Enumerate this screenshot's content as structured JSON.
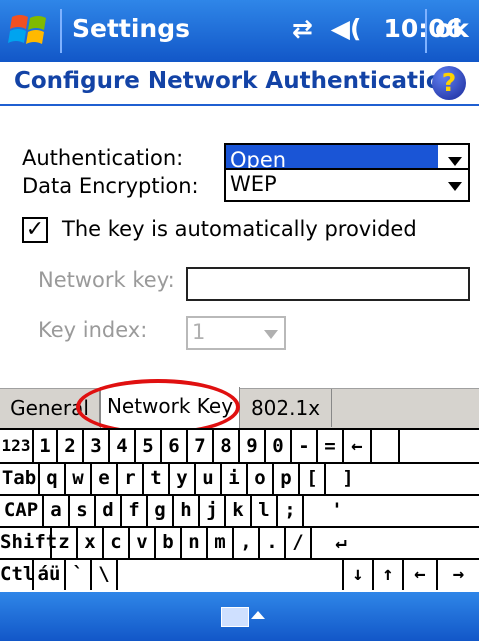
{
  "titlebar": {
    "title": "Settings",
    "time": "10:06",
    "ok_label": "ok"
  },
  "page": {
    "heading": "Configure Network Authentication"
  },
  "form": {
    "authentication": {
      "label": "Authentication:",
      "value": "Open"
    },
    "encryption": {
      "label": "Data Encryption:",
      "value": "WEP"
    },
    "auto_key": {
      "label": "The key is automatically provided",
      "checked": true
    },
    "network_key": {
      "label": "Network key:",
      "value": ""
    },
    "key_index": {
      "label": "Key index:",
      "value": "1"
    }
  },
  "tabs": [
    "General",
    "Network Key",
    "802.1x"
  ],
  "keyboard": {
    "rows": [
      [
        "123",
        "1",
        "2",
        "3",
        "4",
        "5",
        "6",
        "7",
        "8",
        "9",
        "0",
        "-",
        "=",
        "←"
      ],
      [
        "Tab",
        "q",
        "w",
        "e",
        "r",
        "t",
        "y",
        "u",
        "i",
        "o",
        "p",
        "[",
        "]"
      ],
      [
        "CAP",
        "a",
        "s",
        "d",
        "f",
        "g",
        "h",
        "j",
        "k",
        "l",
        ";",
        "'"
      ],
      [
        "Shift",
        "z",
        "x",
        "c",
        "v",
        "b",
        "n",
        "m",
        ",",
        ".",
        "/",
        "↵"
      ],
      [
        "Ctl",
        "áü",
        "`",
        "\\",
        "",
        "↓",
        "↑",
        "←",
        "→"
      ]
    ]
  },
  "colors": {
    "titlebar": "#1a62d4",
    "heading": "#1343a6",
    "selection": "#1a55d6",
    "annotation": "#e01010"
  }
}
